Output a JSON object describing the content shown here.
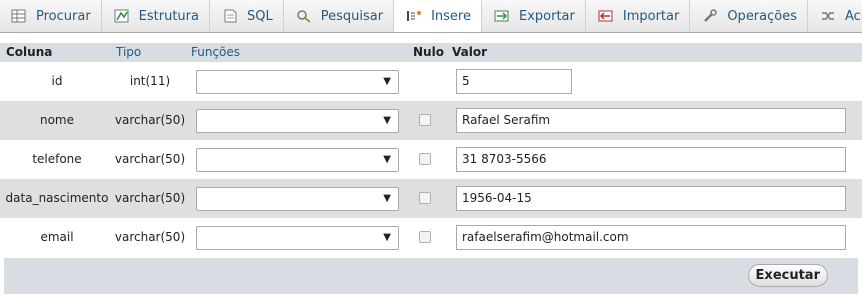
{
  "tabs": [
    {
      "label": "Procurar",
      "icon": "browse-icon"
    },
    {
      "label": "Estrutura",
      "icon": "structure-icon"
    },
    {
      "label": "SQL",
      "icon": "sql-icon"
    },
    {
      "label": "Pesquisar",
      "icon": "search-icon"
    },
    {
      "label": "Insere",
      "icon": "insert-icon"
    },
    {
      "label": "Exportar",
      "icon": "export-icon"
    },
    {
      "label": "Importar",
      "icon": "import-icon"
    },
    {
      "label": "Operações",
      "icon": "operations-icon"
    },
    {
      "label": "Acio",
      "icon": "triggers-icon"
    }
  ],
  "active_tab": "Insere",
  "table": {
    "headers": {
      "coluna": "Coluna",
      "tipo": "Tipo",
      "funcoes": "Funções",
      "nulo": "Nulo",
      "valor": "Valor"
    },
    "rows": [
      {
        "name": "id",
        "type": "int(11)",
        "value": "5",
        "function": ""
      },
      {
        "name": "nome",
        "type": "varchar(50)",
        "value": "Rafael Serafim",
        "function": ""
      },
      {
        "name": "telefone",
        "type": "varchar(50)",
        "value": "31 8703-5566",
        "function": ""
      },
      {
        "name": "data_nascimento",
        "type": "varchar(50)",
        "value": "1956-04-15",
        "function": ""
      },
      {
        "name": "email",
        "type": "varchar(50)",
        "value": "rafaelserafim@hotmail.com",
        "function": ""
      }
    ]
  },
  "footer": {
    "execute_label": "Executar"
  },
  "colors": {
    "link": "#235a81",
    "header_bg": "#d8dde4",
    "row_shade": "#dfdfdf"
  }
}
